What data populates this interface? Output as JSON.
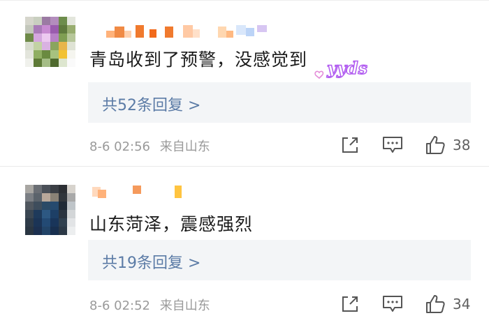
{
  "comments": [
    {
      "text": "青岛收到了预警，没感觉到",
      "reply_label": "共52条回复 >",
      "timestamp": "8-6 02:56",
      "source": "来自山东",
      "likes": "38",
      "sticker_text": "yyds"
    },
    {
      "text": "山东菏泽，震感强烈",
      "reply_label": "共19条回复 >",
      "timestamp": "8-6 02:52",
      "source": "来自山东",
      "likes": "34"
    }
  ],
  "icons": {
    "share": "share-icon",
    "comment": "comment-icon",
    "like": "thumbs-up-icon"
  },
  "colors": {
    "reply_link": "#5b7ba6",
    "reply_bg": "#f3f5f7",
    "meta_text": "#9a9a9a",
    "sticker": "#b15cf0"
  }
}
